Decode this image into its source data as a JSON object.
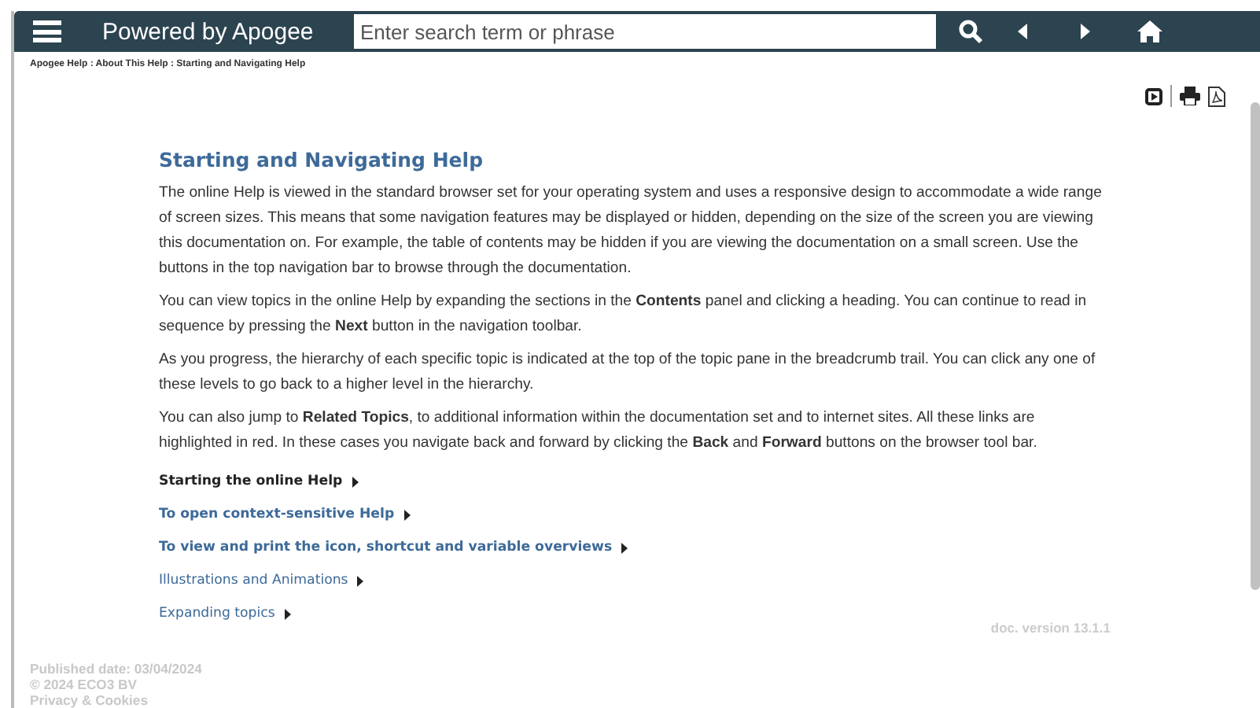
{
  "header": {
    "title": "Powered by Apogee",
    "search": {
      "placeholder": "Enter search term or phrase"
    }
  },
  "breadcrumb": "Apogee Help : About This Help : Starting and Navigating Help",
  "topic": {
    "title": "Starting and Navigating Help",
    "paragraphs": [
      "The online Help is viewed in the standard browser set for your operating system and uses a responsive design to accommodate a wide range of screen sizes. This means that some navigation features may be displayed or hidden, depending on the size of the screen you are viewing this documentation on. For example, the table of contents may be hidden if you are viewing the documentation on a small screen. Use the buttons in the top navigation bar to browse through the documentation.",
      "You can view topics in the online Help by expanding the sections in the **Contents** panel and clicking a heading. You can continue to read in sequence by pressing the **Next** button in the navigation toolbar.",
      "As you progress, the hierarchy of each specific topic is indicated at the top of the topic pane in the breadcrumb trail. You can click any one of these levels to go back to a higher level in the hierarchy.",
      "You can also jump to **Related Topics**, to additional information within the documentation set and to internet sites. All these links are highlighted in red. In these cases you navigate back and forward by clicking the **Back** and **Forward** buttons on the browser tool bar."
    ],
    "links": [
      {
        "label": "Starting the online Help",
        "kind": "bold",
        "hovered": true
      },
      {
        "label": "To open context-sensitive Help",
        "kind": "bold",
        "hovered": false
      },
      {
        "label": "To view and print the icon, shortcut and variable overviews",
        "kind": "bold",
        "hovered": false
      },
      {
        "label": "Illustrations and Animations",
        "kind": "normal",
        "hovered": false
      },
      {
        "label": "Expanding topics",
        "kind": "normal",
        "hovered": false
      }
    ],
    "version": "doc. version 13.1.1"
  },
  "footer": [
    "Published date: 03/04/2024",
    "© 2024 ECO3 BV",
    "Privacy & Cookies"
  ]
}
